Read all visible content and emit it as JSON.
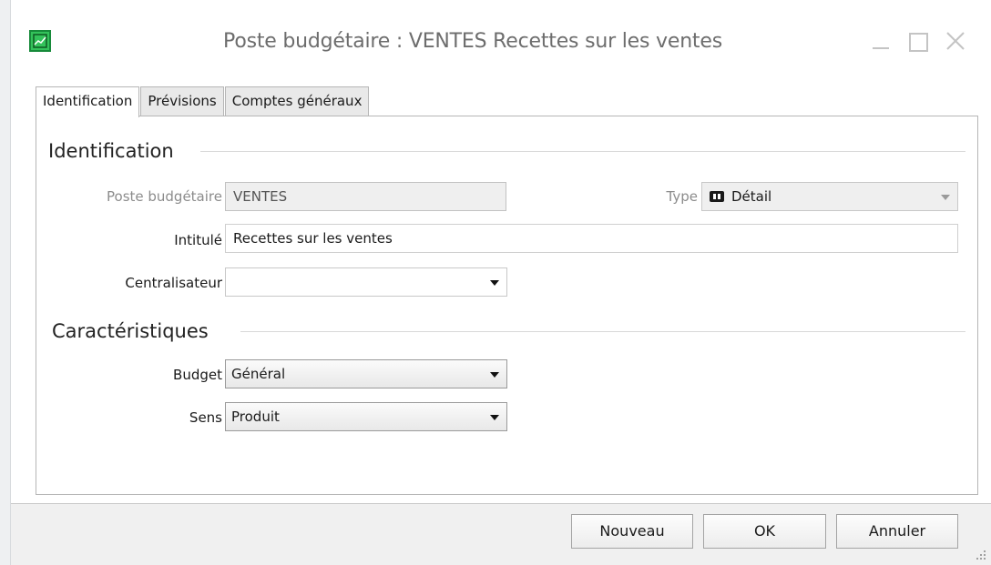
{
  "window": {
    "title": "Poste budgétaire : VENTES Recettes sur les ventes"
  },
  "tabs": [
    {
      "label": "Identification",
      "active": true
    },
    {
      "label": "Prévisions",
      "active": false
    },
    {
      "label": "Comptes généraux",
      "active": false
    }
  ],
  "identification": {
    "section_title": "Identification",
    "poste_label": "Poste budgétaire",
    "poste_value": "VENTES",
    "type_label": "Type",
    "type_value": "Détail",
    "type_icon": "detail-icon",
    "intitule_label": "Intitulé",
    "intitule_value": "Recettes sur les ventes",
    "centralisateur_label": "Centralisateur",
    "centralisateur_value": ""
  },
  "caracteristiques": {
    "section_title": "Caractéristiques",
    "budget_label": "Budget",
    "budget_value": "Général",
    "sens_label": "Sens",
    "sens_value": "Produit"
  },
  "footer": {
    "nouveau_label": "Nouveau",
    "ok_label": "OK",
    "annuler_label": "Annuler"
  },
  "colors": {
    "app_icon_green": "#33c25a",
    "panel_border": "#b6b6b6",
    "footer_bg": "#f0f0f0"
  }
}
